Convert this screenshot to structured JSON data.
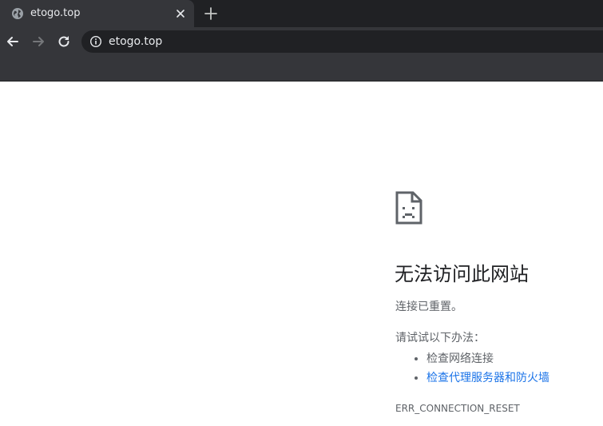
{
  "tab": {
    "title": "etogo.top",
    "favicon": "globe-icon"
  },
  "toolbar": {
    "back_icon": "back-arrow-icon",
    "forward_icon": "forward-arrow-icon",
    "reload_icon": "reload-icon",
    "url": "etogo.top",
    "security_icon": "info-icon"
  },
  "error": {
    "icon": "sad-document-icon",
    "title": "无法访问此网站",
    "subtitle": "连接已重置。",
    "suggestions_heading": "请试试以下办法：",
    "suggestions": [
      "检查网络连接",
      "检查代理服务器和防火墙"
    ],
    "code": "ERR_CONNECTION_RESET"
  },
  "colors": {
    "chrome_dark": "#202124",
    "chrome_toolbar": "#35363a",
    "link_blue": "#1a73e8",
    "text_gray": "#5f6368"
  }
}
